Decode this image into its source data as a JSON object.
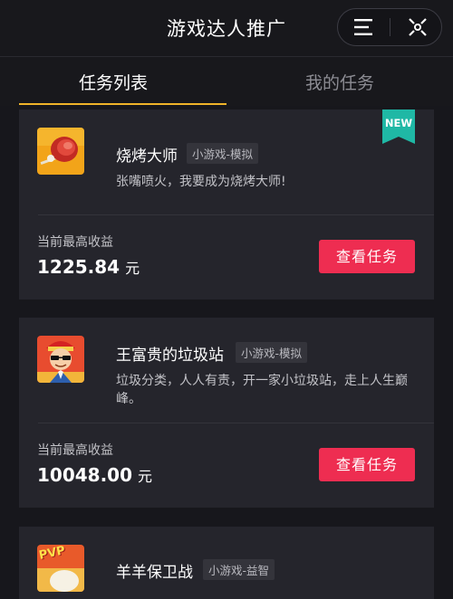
{
  "header": {
    "title": "游戏达人推广"
  },
  "capsule": {
    "menu_icon": "hamburger-menu-icon",
    "close_icon": "target-close-icon"
  },
  "tabs": [
    {
      "label": "任务列表",
      "active": true
    },
    {
      "label": "我的任务",
      "active": false
    }
  ],
  "colors": {
    "accent": "#f0b429",
    "button": "#ee2d51",
    "new_badge": "#1fb8a5"
  },
  "tasks": [
    {
      "name": "烧烤大师",
      "tag": "小游戏-模拟",
      "description": "张嘴喷火，我要成为烧烤大师!",
      "badge": "NEW",
      "earning_label": "当前最高收益",
      "earning_value": "1225.84",
      "earning_unit": "元",
      "button_label": "查看任务"
    },
    {
      "name": "王富贵的垃圾站",
      "tag": "小游戏-模拟",
      "description": "垃圾分类，人人有责，开一家小垃圾站，走上人生巅峰。",
      "earning_label": "当前最高收益",
      "earning_value": "10048.00",
      "earning_unit": "元",
      "button_label": "查看任务"
    },
    {
      "name": "羊羊保卫战",
      "tag": "小游戏-益智",
      "icon_text": "PVP"
    }
  ]
}
